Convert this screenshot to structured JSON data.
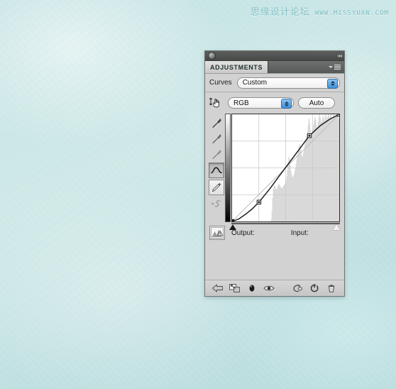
{
  "background": {
    "color": "#c6e4e4",
    "watermark_cn": "思缘设计论坛",
    "watermark_en": "WWW.MISSYUAN.COM"
  },
  "panel": {
    "titlebar": {
      "dot_icon": "circle-icon",
      "collapse_icon": "collapse-double-arrow-icon"
    },
    "tab": {
      "label": "ADJUSTMENTS",
      "menu_icon": "panel-menu-icon"
    },
    "preset_row": {
      "label": "Curves",
      "value": "Custom",
      "stepper_icon": "stepper-updown-icon",
      "stepper_color": "#3f8fd8"
    },
    "channel_row": {
      "on_image_icon": "on-image-adjustment-hand-icon",
      "channel": "RGB",
      "auto_label": "Auto"
    },
    "tools": [
      {
        "name": "black-point-eyedropper-icon",
        "state": "normal"
      },
      {
        "name": "gray-point-eyedropper-icon",
        "state": "normal"
      },
      {
        "name": "white-point-eyedropper-icon",
        "state": "normal"
      },
      {
        "name": "curve-point-tool-icon",
        "state": "pressed"
      },
      {
        "name": "pencil-draw-curve-tool-icon",
        "state": "boxed"
      },
      {
        "name": "smooth-curve-button-icon",
        "state": "disabled"
      }
    ],
    "graph": {
      "vertical_gradient_top": "#ffffff",
      "vertical_gradient_bottom": "#000000",
      "horizontal_gradient_left": "#000000",
      "horizontal_gradient_right": "#ffffff",
      "black_slider_icon": "black-point-slider-icon",
      "white_slider_icon": "white-point-slider-icon"
    },
    "io_row": {
      "icon": "histogram-warning-icon",
      "output_label": "Output:",
      "output_value": "",
      "input_label": "Input:",
      "input_value": ""
    },
    "bottom_bar": [
      {
        "name": "return-to-adjustment-list-icon"
      },
      {
        "name": "clip-to-layer-icon"
      },
      {
        "name": "toggle-layer-visibility-icon"
      },
      {
        "name": "preview-eye-icon"
      },
      {
        "name": "view-previous-state-icon"
      },
      {
        "name": "reset-adjustment-icon"
      },
      {
        "name": "delete-adjustment-layer-icon"
      }
    ]
  },
  "chart_data": {
    "type": "line",
    "title": "Curves",
    "xlabel": "Input",
    "ylabel": "Output",
    "xlim": [
      0,
      255
    ],
    "ylim": [
      0,
      255
    ],
    "grid": true,
    "grid_divisions": 4,
    "legend": "none",
    "series": [
      {
        "name": "diagonal-baseline",
        "style": "straight-reference-line",
        "color": "#c0c0c0",
        "x": [
          0,
          255
        ],
        "y": [
          0,
          255
        ]
      },
      {
        "name": "rgb-curve",
        "style": "s-curve",
        "color": "#1f1f1f",
        "control_points": [
          {
            "input": 0,
            "output": 0
          },
          {
            "input": 64,
            "output": 46
          },
          {
            "input": 184,
            "output": 204
          },
          {
            "input": 255,
            "output": 255
          }
        ],
        "x": [
          0,
          16,
          32,
          48,
          64,
          90,
          115,
          140,
          160,
          184,
          210,
          232,
          255
        ],
        "y": [
          0,
          6,
          17,
          30,
          46,
          78,
          112,
          145,
          172,
          204,
          228,
          243,
          255
        ]
      }
    ],
    "histogram": {
      "name": "rgb-histogram",
      "color": "#d8d8d8",
      "bins": [
        0,
        0,
        0,
        0,
        0,
        0,
        0,
        0,
        0,
        0,
        0,
        0,
        0,
        0,
        0,
        0,
        0,
        0,
        0,
        0,
        0,
        0,
        0,
        0,
        0,
        0,
        0,
        0,
        0,
        0,
        0,
        0,
        0,
        0,
        0,
        0,
        0,
        0,
        0,
        0,
        0,
        0,
        0,
        0,
        0,
        0,
        0,
        0,
        0,
        0,
        0,
        0,
        0,
        0,
        0,
        0,
        0,
        0,
        2,
        10,
        22,
        30,
        34,
        33,
        31,
        30,
        30,
        31,
        33,
        35,
        34,
        33,
        32,
        31,
        31,
        32,
        33,
        34,
        35,
        36,
        38,
        42,
        48,
        55,
        60,
        58,
        52,
        47,
        44,
        42,
        41,
        42,
        44,
        47,
        50,
        54,
        58,
        62,
        66,
        70,
        72,
        70,
        66,
        62,
        60,
        61,
        64,
        68,
        72,
        76,
        78,
        80,
        84,
        90,
        96,
        92,
        86,
        82,
        80,
        82,
        86,
        90,
        94,
        97,
        95,
        90,
        86,
        88,
        93,
        97,
        100,
        97,
        93,
        92,
        95,
        99,
        97,
        94,
        96,
        100,
        98,
        95,
        97,
        100,
        98,
        96,
        99,
        100,
        97,
        95,
        98,
        100,
        99,
        97,
        96,
        98,
        100,
        98,
        96,
        95
      ]
    }
  }
}
